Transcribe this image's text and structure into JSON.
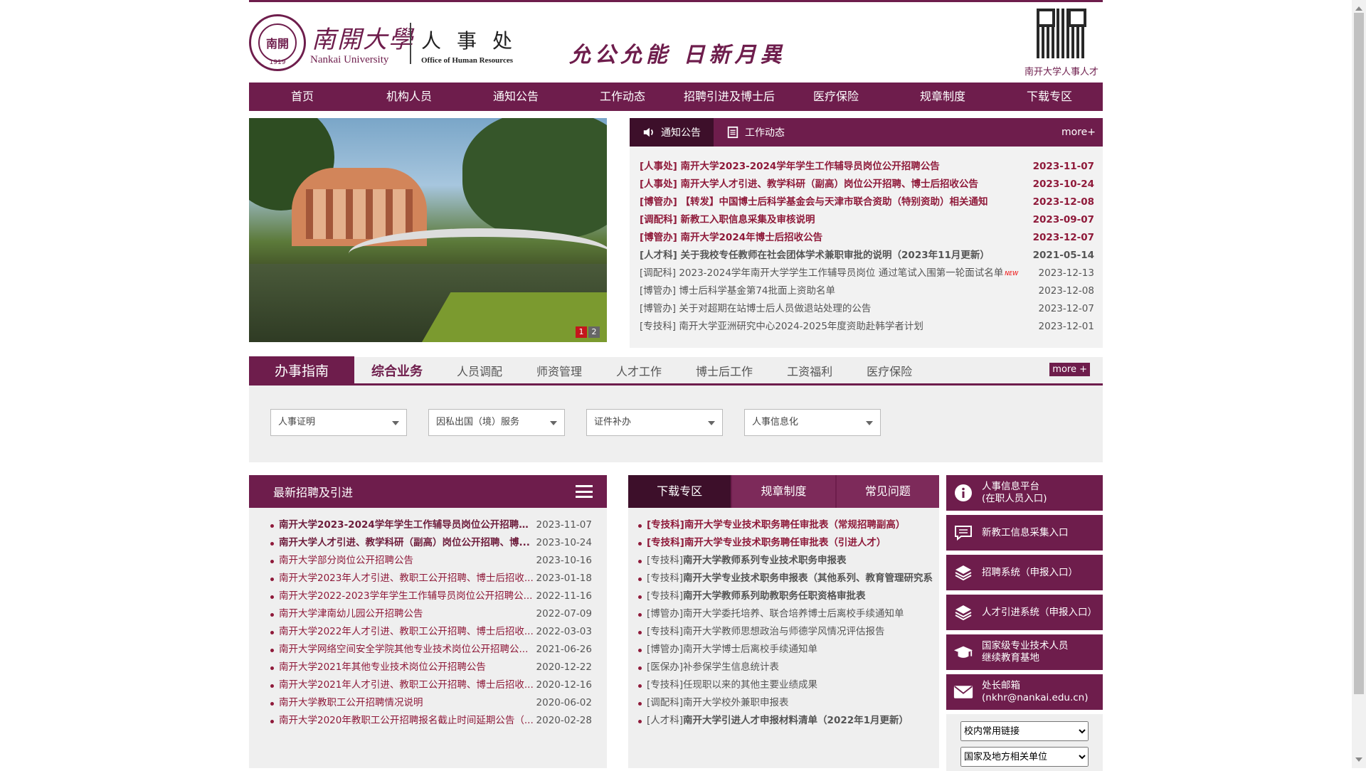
{
  "header": {
    "seal_text": "南開",
    "seal_year": "1919",
    "university_cn": "南開大學",
    "university_en": "Nankai University",
    "dept_cn": "人事处",
    "dept_en": "Office of Human Resources",
    "motto": "允公允能 日新月異",
    "qr_caption": "南开大学人事人才"
  },
  "nav": [
    "首页",
    "机构人员",
    "通知公告",
    "工作动态",
    "招聘引进及博士后",
    "医疗保险",
    "规章制度",
    "下载专区"
  ],
  "banner": {
    "dots": [
      "1",
      "2"
    ],
    "active_dot": 0
  },
  "notice": {
    "tabs": [
      "通知公告",
      "工作动态"
    ],
    "active_tab": 0,
    "more": "more+",
    "items": [
      {
        "title": "[人事处] 南开大学2023-2024学年学生工作辅导员岗位公开招聘公告",
        "date": "2023-11-07",
        "hot": true
      },
      {
        "title": "[人事处] 南开大学人才引进、教学科研（副高）岗位公开招聘、博士后招收公告",
        "date": "2023-10-24",
        "hot": true
      },
      {
        "title": "[博管办] 【转发】中国博士后科学基金会与天津市联合资助（特别资助）相关通知",
        "date": "2023-12-08",
        "hot": true
      },
      {
        "title": "[调配科] 新教工入职信息采集及审核说明",
        "date": "2023-09-07",
        "hot": true
      },
      {
        "title": "[博管办] 南开大学2024年博士后招收公告",
        "date": "2023-12-07",
        "hot": true
      },
      {
        "title": "[人才科] 关于我校专任教师在社会团体学术兼职审批的说明（2023年11月更新）",
        "date": "2021-05-14",
        "hot": false,
        "semi": true
      },
      {
        "title": "[调配科] 2023-2024学年南开大学学生工作辅导员岗位 通过笔试入围第一轮面试名单",
        "date": "2023-12-13",
        "hot": false,
        "badge": "NEW"
      },
      {
        "title": "[博管办] 博士后科学基金第74批面上资助名单",
        "date": "2023-12-08",
        "hot": false
      },
      {
        "title": "[博管办] 关于对超期在站博士后人员做退站处理的公告",
        "date": "2023-12-07",
        "hot": false
      },
      {
        "title": "[专技科] 南开大学亚洲研究中心2024-2025年度资助赴韩学者计划",
        "date": "2023-12-01",
        "hot": false
      }
    ]
  },
  "guide": {
    "title": "办事指南",
    "tabs": [
      "综合业务",
      "人员调配",
      "师资管理",
      "人才工作",
      "博士后工作",
      "工资福利",
      "医疗保险"
    ],
    "active_tab": 0,
    "more": "more +",
    "selects": [
      "人事证明",
      "因私出国（境）服务",
      "证件补办",
      "人事信息化"
    ]
  },
  "recruit": {
    "title": "最新招聘及引进",
    "items": [
      {
        "title": "南开大学2023-2024学年学生工作辅导员岗位公开招聘公...",
        "date": "2023-11-07",
        "hot": true
      },
      {
        "title": "南开大学人才引进、教学科研（副高）岗位公开招聘、博...",
        "date": "2023-10-24",
        "hot": true
      },
      {
        "title": "南开大学部分岗位公开招聘公告",
        "date": "2023-10-16"
      },
      {
        "title": "南开大学2023年人才引进、教职工公开招聘、博士后招收...",
        "date": "2023-01-18"
      },
      {
        "title": "南开大学2022-2023学年学生工作辅导员岗位公开招聘公...",
        "date": "2022-11-16"
      },
      {
        "title": "南开大学津南幼儿园公开招聘公告",
        "date": "2022-07-09"
      },
      {
        "title": "南开大学2022年人才引进、教职工公开招聘、博士后招收...",
        "date": "2022-03-03"
      },
      {
        "title": "南开大学网络空间安全学院其他专业技术岗位公开招聘公...",
        "date": "2021-06-26"
      },
      {
        "title": "南开大学2021年其他专业技术岗位公开招聘公告",
        "date": "2020-12-22"
      },
      {
        "title": "南开大学2021年人才引进、教职工公开招聘、博士后招收...",
        "date": "2020-12-16"
      },
      {
        "title": "南开大学教职工公开招聘情况说明",
        "date": "2020-06-02"
      },
      {
        "title": "南开大学2020年教职工公开招聘报名截止时间延期公告（...",
        "date": "2020-02-28"
      }
    ]
  },
  "downloads": {
    "tabs": [
      "下载专区",
      "规章制度",
      "常见问题"
    ],
    "active_tab": 0,
    "items": [
      {
        "cat": "[专技科]",
        "title": "南开大学专业技术职务聘任审批表（常规招聘副高）",
        "hot": true
      },
      {
        "cat": "[专技科]",
        "title": "南开大学专业技术职务聘任审批表（引进人才）",
        "hot": true
      },
      {
        "cat": "[专技科]",
        "title": "南开大学教师系列专业技术职务申报表",
        "semi": true
      },
      {
        "cat": "[专技科]",
        "title": "南开大学专业技术职务申报表（其他系列、教育管理研究系",
        "semi": true
      },
      {
        "cat": "[专技科]",
        "title": "南开大学教师系列助教职务任职资格审批表",
        "semi": true
      },
      {
        "cat": "[博管办]",
        "title": "南开大学委托培养、联合培养博士后离校手续通知单"
      },
      {
        "cat": "[专技科]",
        "title": "南开大学教师思想政治与师德学风情况评估报告"
      },
      {
        "cat": "[博管办]",
        "title": "南开大学博士后离校手续通知单"
      },
      {
        "cat": "[医保办]",
        "title": "补参保学生信息统计表"
      },
      {
        "cat": "[专技科]",
        "title": "任现职以来的其他主要业绩成果"
      },
      {
        "cat": "[调配科]",
        "title": "南开大学校外兼职申报表"
      },
      {
        "cat": "[人才科]",
        "title": "南开大学引进人才申报材料清单（2022年1月更新）",
        "semi": true
      }
    ]
  },
  "side": {
    "buttons": [
      {
        "icon": "info-icon",
        "line1": "人事信息平台",
        "line2": "(在职人员入口)"
      },
      {
        "icon": "message-icon",
        "line1": "新教工信息采集入口",
        "line2": ""
      },
      {
        "icon": "layers-icon",
        "line1": "招聘系统（申报入口）",
        "line2": ""
      },
      {
        "icon": "layers-icon",
        "line1": "人才引进系统（申报入口）",
        "line2": ""
      },
      {
        "icon": "graduation-cap-icon",
        "line1": "国家级专业技术人员",
        "line2": "继续教育基地"
      },
      {
        "icon": "mail-icon",
        "line1": "处长邮箱",
        "line2": "(nkhr@nankai.edu.cn)"
      }
    ],
    "select1": "校内常用链接",
    "select2": "国家及地方相关单位"
  },
  "colors": {
    "brand": "#6e1d4c",
    "accent_red": "#8f1a3a"
  }
}
